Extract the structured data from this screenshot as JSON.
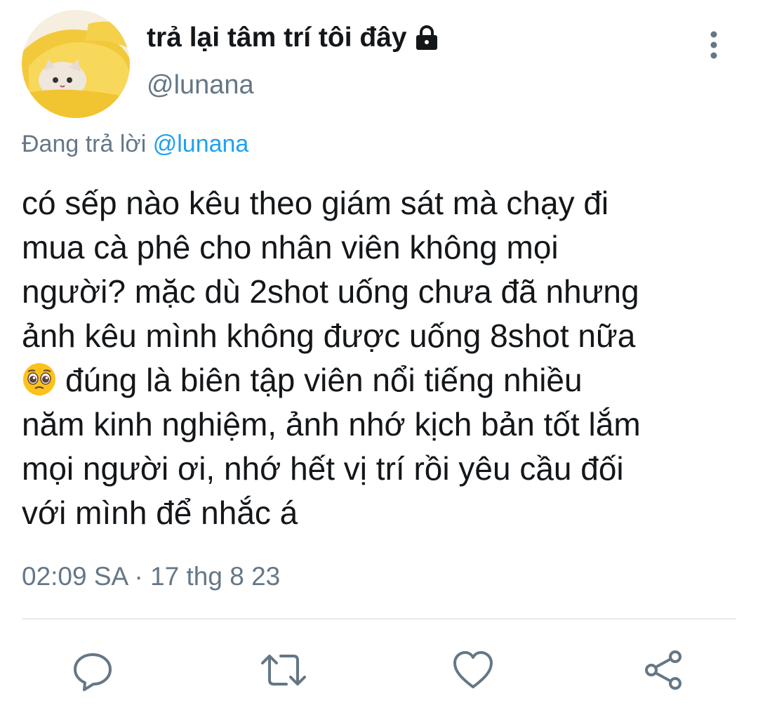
{
  "tweet": {
    "display_name": "trả lại tâm trí tôi đây",
    "handle": "@lunana",
    "replying_prefix": "Đang trả lời",
    "replying_to": "@lunana",
    "body_lines": [
      "có sếp nào kêu theo giám sát mà chạy đi",
      "mua cà phê cho nhân viên không mọi",
      "người? mặc dù 2shot uống chưa đã nhưng",
      "ảnh kêu mình không được uống 8shot nữa",
      "đúng là biên tập viên nổi tiếng nhiều",
      "năm kinh nghiệm, ảnh nhớ kịch bản tốt lắm",
      "mọi người ơi, nhớ hết vị trí rồi yêu cầu đối",
      "với mình để nhắc á"
    ],
    "timestamp": "02:09 SA · 17 thg 8 23"
  },
  "icons": {
    "avatar": "cat-in-yellow-blanket-avatar",
    "lock": "lock-icon",
    "more": "more-vertical-icon",
    "emoji": "pleading-face-emoji",
    "actions": [
      "reply-icon",
      "retweet-icon",
      "like-icon",
      "share-icon"
    ]
  },
  "colors": {
    "text": "#14171a",
    "secondary": "#657786",
    "link": "#1da1f2",
    "divider": "#e6ecf0"
  }
}
